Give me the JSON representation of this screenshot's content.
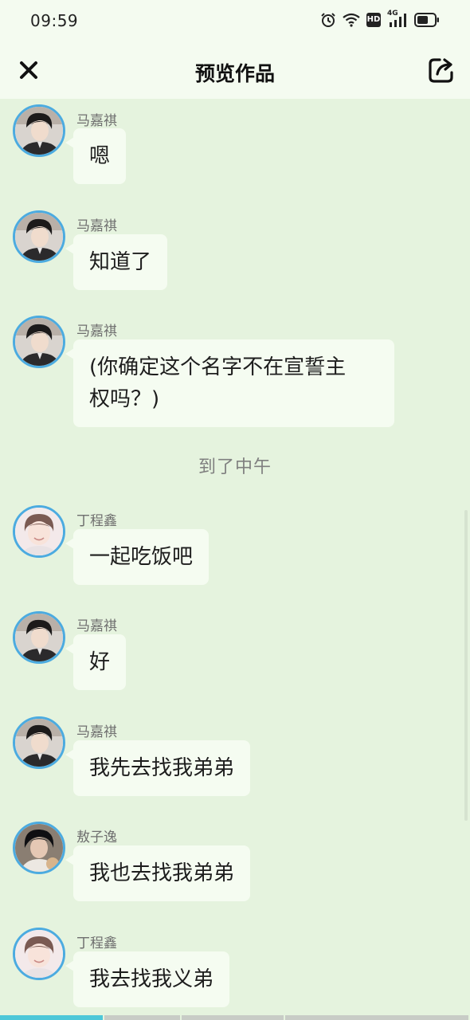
{
  "status_bar": {
    "time": "09:59",
    "icons": [
      "alarm-icon",
      "wifi-icon",
      "hd-icon",
      "4g-signal-icon",
      "battery-icon"
    ],
    "hd_label": "HD",
    "network_label": "4G"
  },
  "header": {
    "title": "预览作品",
    "close_icon": "close-icon",
    "share_icon": "share-icon"
  },
  "messages": [
    {
      "sender": "马嘉祺",
      "text": "嗯",
      "avatar": "avatar-majiaqi"
    },
    {
      "sender": "马嘉祺",
      "text": "知道了",
      "avatar": "avatar-majiaqi"
    },
    {
      "sender": "马嘉祺",
      "text": "(你确定这个名字不在宣誓主",
      "text_line2": "权吗？)",
      "avatar": "avatar-majiaqi"
    },
    {
      "divider": "到了中午"
    },
    {
      "sender": "丁程鑫",
      "text": "一起吃饭吧",
      "avatar": "avatar-dingchengxin"
    },
    {
      "sender": "马嘉祺",
      "text": "好",
      "avatar": "avatar-majiaqi"
    },
    {
      "sender": "马嘉祺",
      "text": "我先去找我弟弟",
      "avatar": "avatar-majiaqi"
    },
    {
      "sender": "敖子逸",
      "text": "我也去找我弟弟",
      "avatar": "avatar-aoziyi"
    },
    {
      "sender": "丁程鑫",
      "text": "我去找我义弟",
      "avatar": "avatar-dingchengxin"
    }
  ],
  "colors": {
    "background": "#e5f3de",
    "header_background": "#f4fbf0",
    "bubble": "#f5fcf1",
    "avatar_ring": "#4cabe0",
    "progress_active": "#4dc7d8"
  }
}
